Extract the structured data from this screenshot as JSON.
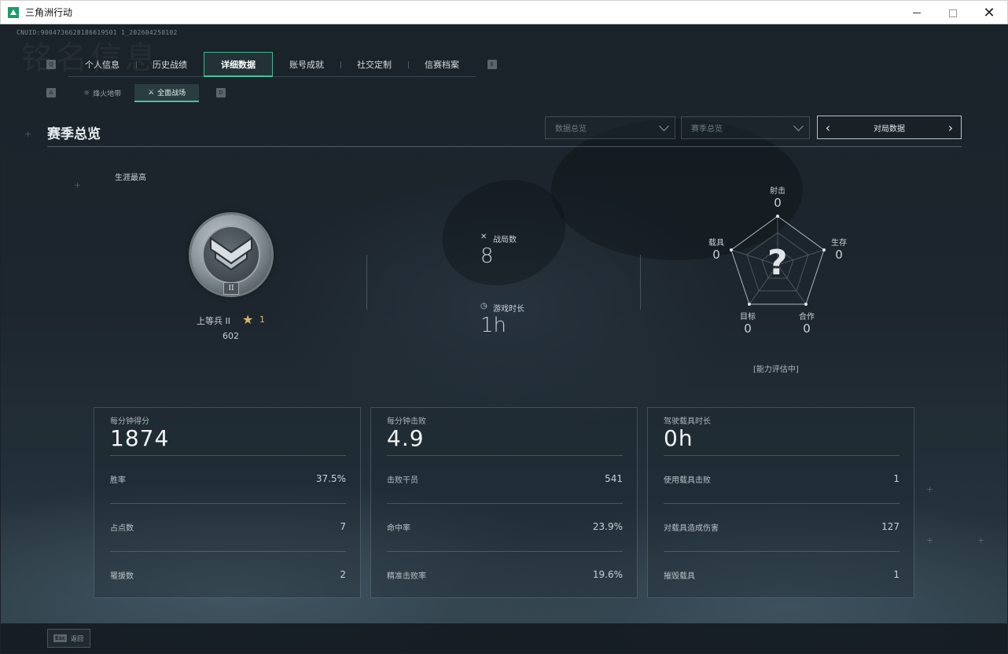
{
  "window": {
    "title": "三角洲行动",
    "minimize_icon": "minimize-icon",
    "maximize_icon": "maximize-icon",
    "close_icon": "close-icon"
  },
  "profile": {
    "uid": "CNUID:9004736628186619501 1_202604250102",
    "watermark": "铭名信息"
  },
  "nav": {
    "left_key": "Q",
    "right_key": "E",
    "tabs": [
      {
        "label": "个人信息",
        "active": false
      },
      {
        "label": "历史战绩",
        "active": false
      },
      {
        "label": "详细数据",
        "active": true
      },
      {
        "label": "账号成就",
        "active": false
      },
      {
        "label": "社交定制",
        "active": false
      },
      {
        "label": "信赛档案",
        "active": false
      }
    ]
  },
  "subnav": {
    "left_key": "A",
    "right_key": "D",
    "tabs": [
      {
        "label": "烽火地带",
        "icon": "flame-zone-icon",
        "active": false
      },
      {
        "label": "全面战场",
        "icon": "battlefield-icon",
        "active": true
      }
    ]
  },
  "header": {
    "title": "赛季总览",
    "dropdown1": "数据总览",
    "dropdown2": "赛季总览",
    "pager_label": "对局数据"
  },
  "career": {
    "label": "生涯最高",
    "rank_name": "上等兵 II",
    "rank_roman": "II",
    "stars": "1",
    "points": "602"
  },
  "summary": {
    "matches_label": "战局数",
    "matches_value": "8",
    "time_label": "游戏时长",
    "time_value": "1h"
  },
  "radar": {
    "axes": [
      {
        "label": "射击",
        "value": "0"
      },
      {
        "label": "生存",
        "value": "0"
      },
      {
        "label": "合作",
        "value": "0"
      },
      {
        "label": "目标",
        "value": "0"
      },
      {
        "label": "载具",
        "value": "0"
      }
    ],
    "unknown_mark": "?",
    "status": "[能力评估中]"
  },
  "cards": [
    {
      "title": "每分钟得分",
      "value": "1874",
      "rows": [
        {
          "label": "胜率",
          "value": "37.5%"
        },
        {
          "label": "占点数",
          "value": "7"
        },
        {
          "label": "罹援数",
          "value": "2"
        }
      ]
    },
    {
      "title": "每分钟击败",
      "value": "4.9",
      "rows": [
        {
          "label": "击败干员",
          "value": "541"
        },
        {
          "label": "命中率",
          "value": "23.9%"
        },
        {
          "label": "精准击败率",
          "value": "19.6%"
        }
      ]
    },
    {
      "title": "驾驶载具时长",
      "value": "0h",
      "rows": [
        {
          "label": "使用载具击败",
          "value": "1"
        },
        {
          "label": "对载具造成伤害",
          "value": "127"
        },
        {
          "label": "摧毁载具",
          "value": "1"
        }
      ]
    }
  ],
  "footer": {
    "esc_key": "Esc",
    "back_label": "返回"
  },
  "colors": {
    "accent": "#46c39a",
    "star": "#d8b66a",
    "background": "#1b2229"
  }
}
